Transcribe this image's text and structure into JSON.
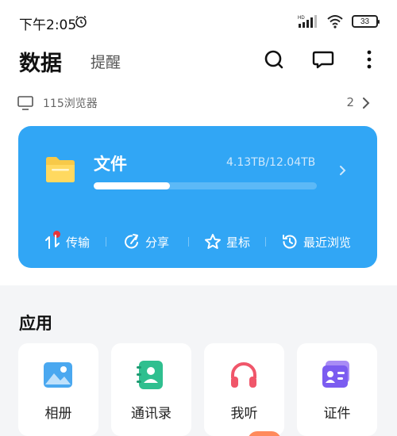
{
  "status_bar": {
    "time": "下午2:05",
    "network_label": "HD",
    "battery": "33"
  },
  "header": {
    "tab_active": "数据",
    "tab_inactive": "提醒",
    "icons": [
      "search-icon",
      "message-icon",
      "more-icon"
    ]
  },
  "device": {
    "label": "115浏览器",
    "count": "2"
  },
  "file_card": {
    "title": "文件",
    "usage": "4.13TB/12.04TB",
    "used_fraction": 0.343,
    "quick_actions": [
      {
        "label": "传输",
        "icon": "transfer-icon",
        "badge": true
      },
      {
        "label": "分享",
        "icon": "share-icon"
      },
      {
        "label": "星标",
        "icon": "star-icon"
      },
      {
        "label": "最近浏览",
        "icon": "recent-icon"
      }
    ],
    "accent": "#31a6f5"
  },
  "apps": {
    "title": "应用",
    "items": [
      {
        "label": "相册",
        "icon": "album-icon"
      },
      {
        "label": "通讯录",
        "icon": "contacts-icon"
      },
      {
        "label": "我听",
        "icon": "headphones-icon"
      },
      {
        "label": "证件",
        "icon": "id-card-icon"
      }
    ]
  }
}
